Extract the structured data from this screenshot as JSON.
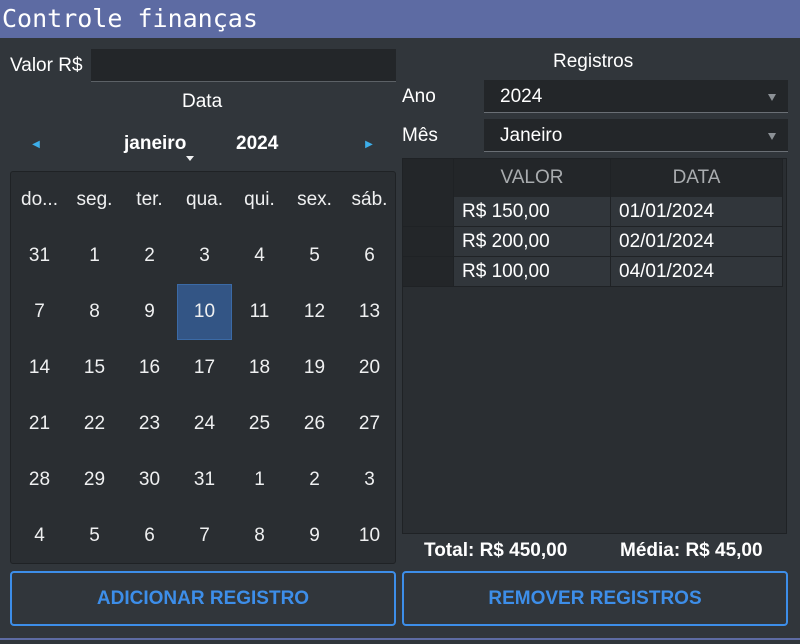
{
  "window": {
    "title": "Controle finanças"
  },
  "form": {
    "valor_label": "Valor R$",
    "valor_value": "",
    "data_label": "Data"
  },
  "calendar": {
    "prev_icon": "triangle-left-icon",
    "next_icon": "triangle-right-icon",
    "month": "janeiro",
    "year": "2024",
    "weekdays": [
      "do...",
      "seg.",
      "ter.",
      "qua.",
      "qui.",
      "sex.",
      "sáb."
    ],
    "weeks": [
      [
        "31",
        "1",
        "2",
        "3",
        "4",
        "5",
        "6"
      ],
      [
        "7",
        "8",
        "9",
        "10",
        "11",
        "12",
        "13"
      ],
      [
        "14",
        "15",
        "16",
        "17",
        "18",
        "19",
        "20"
      ],
      [
        "21",
        "22",
        "23",
        "24",
        "25",
        "26",
        "27"
      ],
      [
        "28",
        "29",
        "30",
        "31",
        "1",
        "2",
        "3"
      ],
      [
        "4",
        "5",
        "6",
        "7",
        "8",
        "9",
        "10"
      ]
    ],
    "selected_day": "10",
    "selected_color": "#335585"
  },
  "registros": {
    "heading": "Registros",
    "ano_label": "Ano",
    "ano_value": "2024",
    "mes_label": "Mês",
    "mes_value": "Janeiro",
    "columns": [
      "VALOR",
      "DATA"
    ],
    "rows": [
      {
        "valor": "R$ 150,00",
        "data": "01/01/2024"
      },
      {
        "valor": "R$ 200,00",
        "data": "02/01/2024"
      },
      {
        "valor": "R$ 100,00",
        "data": "04/01/2024"
      }
    ],
    "total": "Total: R$ 450,00",
    "media": "Média: R$ 45,00"
  },
  "buttons": {
    "add_label": "ADICIONAR REGISTRO",
    "remove_label": "REMOVER REGISTROS"
  },
  "colors": {
    "accent": "#3d8ee9",
    "titlebar": "#5d6ba3",
    "background": "#31363b"
  }
}
